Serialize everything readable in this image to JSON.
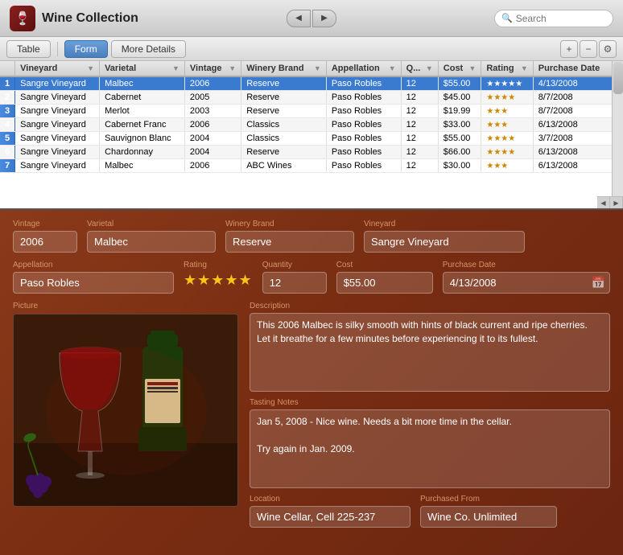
{
  "app": {
    "title": "Wine Collection",
    "icon": "🍷"
  },
  "nav": {
    "back_label": "◀",
    "forward_label": "▶"
  },
  "search": {
    "placeholder": "Search",
    "value": ""
  },
  "tabs": [
    {
      "id": "table",
      "label": "Table",
      "active": false
    },
    {
      "id": "form",
      "label": "Form",
      "active": true
    },
    {
      "id": "more-details",
      "label": "More Details",
      "active": false
    }
  ],
  "toolbar": {
    "add_label": "+",
    "remove_label": "−",
    "action_label": "⚙"
  },
  "table": {
    "columns": [
      {
        "id": "vineyard",
        "label": "Vineyard"
      },
      {
        "id": "varietal",
        "label": "Varietal"
      },
      {
        "id": "vintage",
        "label": "Vintage"
      },
      {
        "id": "winery",
        "label": "Winery Brand"
      },
      {
        "id": "appellation",
        "label": "Appellation"
      },
      {
        "id": "quantity",
        "label": "Q..."
      },
      {
        "id": "cost",
        "label": "Cost"
      },
      {
        "id": "rating",
        "label": "Rating"
      },
      {
        "id": "purchase_date",
        "label": "Purchase Date"
      }
    ],
    "rows": [
      {
        "num": 1,
        "vineyard": "Sangre Vineyard",
        "varietal": "Malbec",
        "vintage": "2006",
        "winery": "Reserve",
        "appellation": "Paso Robles",
        "quantity": "12",
        "cost": "$55.00",
        "rating": "★★★★★",
        "purchase_date": "4/13/2008",
        "selected": true
      },
      {
        "num": 2,
        "vineyard": "Sangre Vineyard",
        "varietal": "Cabernet",
        "vintage": "2005",
        "winery": "Reserve",
        "appellation": "Paso Robles",
        "quantity": "12",
        "cost": "$45.00",
        "rating": "★★★★",
        "purchase_date": "8/7/2008",
        "selected": false
      },
      {
        "num": 3,
        "vineyard": "Sangre Vineyard",
        "varietal": "Merlot",
        "vintage": "2003",
        "winery": "Reserve",
        "appellation": "Paso Robles",
        "quantity": "12",
        "cost": "$19.99",
        "rating": "★★★",
        "purchase_date": "8/7/2008",
        "selected": false
      },
      {
        "num": 4,
        "vineyard": "Sangre Vineyard",
        "varietal": "Cabernet Franc",
        "vintage": "2006",
        "winery": "Classics",
        "appellation": "Paso Robles",
        "quantity": "12",
        "cost": "$33.00",
        "rating": "★★★",
        "purchase_date": "6/13/2008",
        "selected": false
      },
      {
        "num": 5,
        "vineyard": "Sangre Vineyard",
        "varietal": "Sauvignon Blanc",
        "vintage": "2004",
        "winery": "Classics",
        "appellation": "Paso Robles",
        "quantity": "12",
        "cost": "$55.00",
        "rating": "★★★★",
        "purchase_date": "3/7/2008",
        "selected": false
      },
      {
        "num": 6,
        "vineyard": "Sangre Vineyard",
        "varietal": "Chardonnay",
        "vintage": "2004",
        "winery": "Reserve",
        "appellation": "Paso Robles",
        "quantity": "12",
        "cost": "$66.00",
        "rating": "★★★★",
        "purchase_date": "6/13/2008",
        "selected": false
      },
      {
        "num": 7,
        "vineyard": "Sangre Vineyard",
        "varietal": "Malbec",
        "vintage": "2006",
        "winery": "ABC Wines",
        "appellation": "Paso Robles",
        "quantity": "12",
        "cost": "$30.00",
        "rating": "★★★",
        "purchase_date": "6/13/2008",
        "selected": false
      }
    ]
  },
  "form": {
    "labels": {
      "vintage": "Vintage",
      "varietal": "Varietal",
      "winery_brand": "Winery Brand",
      "vineyard": "Vineyard",
      "appellation": "Appellation",
      "rating": "Rating",
      "quantity": "Quantity",
      "cost": "Cost",
      "purchase_date": "Purchase Date",
      "picture": "Picture",
      "description": "Description",
      "tasting_notes": "Tasting Notes",
      "location": "Location",
      "purchased_from": "Purchased From"
    },
    "values": {
      "vintage": "2006",
      "varietal": "Malbec",
      "winery_brand": "Reserve",
      "vineyard": "Sangre Vineyard",
      "appellation": "Paso Robles",
      "rating": "★★★★★",
      "quantity": "12",
      "cost": "$55.00",
      "purchase_date": "4/13/2008",
      "description": "This 2006 Malbec is silky smooth with hints of black current and ripe cherries.  Let it breathe for a few minutes before experiencing it to its fullest.",
      "tasting_notes": "Jan 5, 2008 - Nice wine. Needs a bit more time in the cellar.\n\nTry again in Jan. 2009.",
      "location": "Wine Cellar, Cell 225-237",
      "purchased_from": "Wine Co. Unlimited"
    }
  }
}
